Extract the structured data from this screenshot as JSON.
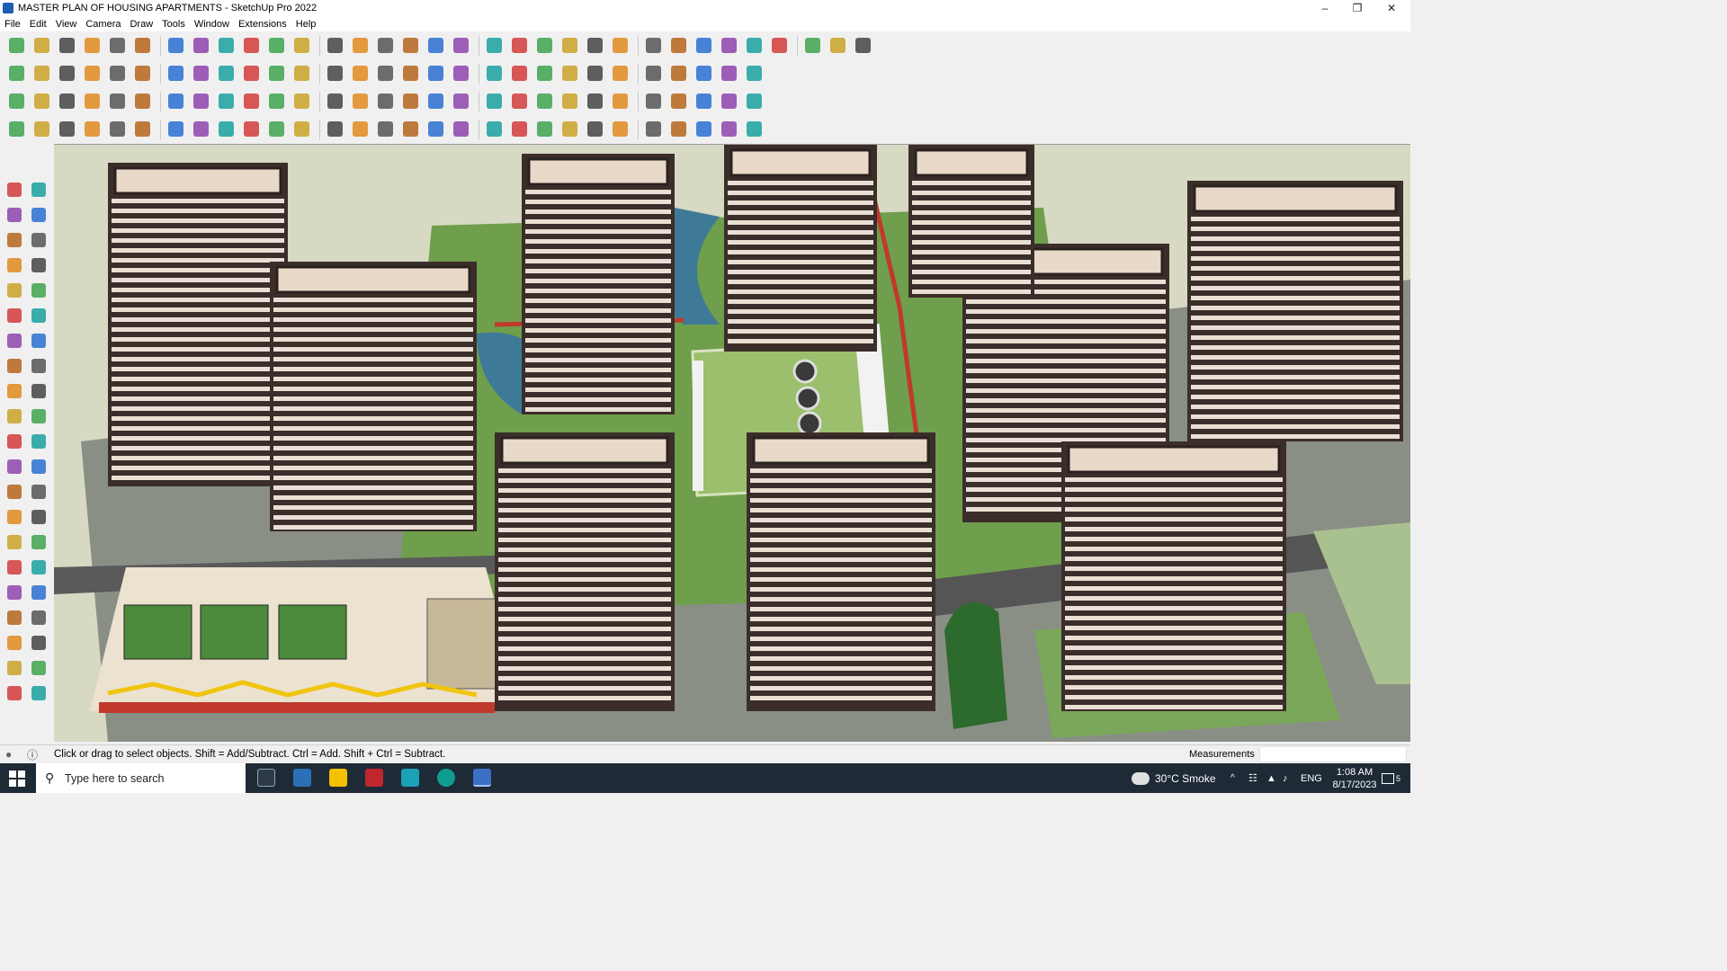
{
  "window": {
    "title": "MASTER PLAN OF HOUSING APARTMENTS - SketchUp Pro 2022",
    "controls": [
      "minimize-icon",
      "restore-icon",
      "close-icon"
    ]
  },
  "menus": [
    "File",
    "Edit",
    "View",
    "Camera",
    "Draw",
    "Tools",
    "Window",
    "Extensions",
    "Help"
  ],
  "toolbars": {
    "row1": [
      "search-icon",
      "select-icon",
      "eraser-icon",
      "pencil-icon",
      "lasso-icon",
      "shape-icon",
      "push-pull-icon",
      "follow-me-icon",
      "move-icon",
      "rotate-icon",
      "scale-icon",
      "tape-icon",
      "text-icon",
      "paint-icon",
      "orbit-icon",
      "pan-icon",
      "zoom-icon",
      "zoom-extents-icon",
      "warehouse-icon",
      "extension-icon",
      "layers-icon",
      "section-icon",
      "account-icon",
      "style-icon",
      "material-icon",
      "blue-arrow-icon",
      "flip-icon",
      "up-down-icon",
      "weld-icon",
      "box-icon",
      "undo-icon",
      "redo-icon",
      "hand-icon"
    ],
    "row2": [
      "cube-icon",
      "cube-shaded-icon",
      "cube-texture-icon",
      "axes-icon",
      "red-arrow-icon",
      "blue-arrow-icon",
      "green-arrow-icon",
      "orange-arrow-icon",
      "purple-arrow-icon",
      "curve-icon",
      "plane-icon",
      "house-icon",
      "roof-icon",
      "wall-icon",
      "stairs-icon",
      "camera-icon",
      "function-icon",
      "fill-icon",
      "knife-icon",
      "circle-icon",
      "hexagon-icon",
      "polygon-icon",
      "ellipse-icon",
      "arc-icon",
      "bezier-icon",
      "fillet-icon",
      "chamfer-icon",
      "draw-line-icon",
      "eraser2-icon"
    ],
    "row3": [
      "blue-plane-icon",
      "yellow-plane-icon",
      "red-face-icon",
      "offset-icon",
      "brick-icon",
      "grid-icon",
      "frame-icon",
      "wood-icon",
      "chain-icon",
      "dots-icon",
      "cross-icon",
      "snowflake-icon",
      "cone-icon",
      "warning-icon",
      "spiral-icon",
      "spring-icon",
      "target-icon",
      "box-open-icon",
      "curl-icon",
      "split-icon",
      "cluster-icon",
      "gem-icon",
      "mesh-icon",
      "window-icon",
      "panel-icon",
      "tile-icon",
      "x-shape-icon",
      "node-icon",
      "scatter-icon"
    ],
    "row4": [
      "bezier-tool-icon",
      "freehand-icon",
      "car-icon",
      "dimension-icon",
      "pipe-icon",
      "chamfer2-icon",
      "sphere-icon",
      "spring2-icon",
      "corner-icon",
      "line-icon",
      "angle-icon",
      "bridge-icon",
      "fence-icon",
      "ramp-icon",
      "rails-icon",
      "rib-icon",
      "stair2-icon",
      "truss-icon",
      "roof2-icon",
      "gable-icon",
      "skew-icon",
      "scissors-icon",
      "spline-icon",
      "hatch-icon",
      "column-icon",
      "slab-icon",
      "louver-icon",
      "facade-icon",
      "balcony-icon"
    ]
  },
  "viewport": {
    "description_hidden": ""
  },
  "status": {
    "message": "Click or drag to select objects. Shift = Add/Subtract. Ctrl = Add. Shift + Ctrl = Subtract.",
    "measurements_label": "Measurements",
    "measurements_value": ""
  },
  "taskbar": {
    "search_placeholder": "Type here to search",
    "weather": "30°C  Smoke",
    "language": "ENG",
    "time": "1:08 AM",
    "date": "8/17/2023",
    "notification_count": "5"
  },
  "colors": {
    "accent": "#1a5fb4",
    "taskbar": "#1f2a37",
    "ground": "#6d9b4a",
    "road": "#4a4a4a",
    "building": "#e8d9c8",
    "building_dark": "#3b2e2a"
  }
}
